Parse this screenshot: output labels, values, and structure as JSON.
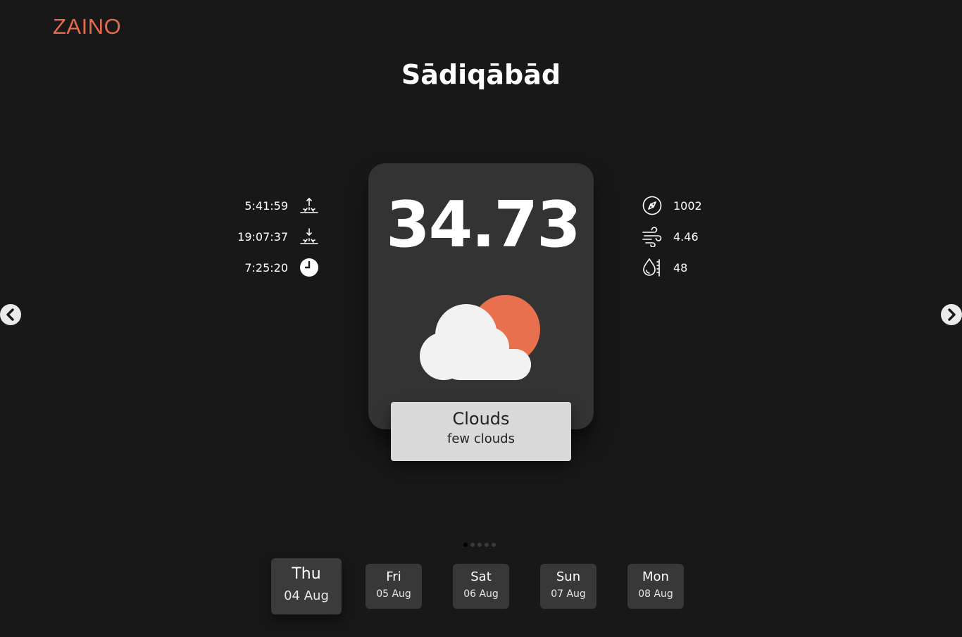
{
  "app": {
    "logo": "ZAINO"
  },
  "location": {
    "city": "Sādiqābād"
  },
  "sun": {
    "sunrise": "5:41:59",
    "sunset": "19:07:37",
    "daylight": "7:25:20"
  },
  "conditions": {
    "pressure": "1002",
    "wind": "4.46",
    "humidity": "48"
  },
  "current": {
    "temperature": "34.73",
    "main": "Clouds",
    "description": "few clouds",
    "icon": "cloud-sun-icon"
  },
  "colors": {
    "accent": "#e66a4c",
    "background": "#181818",
    "card": "#333333",
    "sun": "#e8704e",
    "cloud": "#f2f2f2"
  },
  "pager": {
    "total": 5,
    "active": 0
  },
  "forecast": [
    {
      "day": "Thu",
      "date": "04 Aug"
    },
    {
      "day": "Fri",
      "date": "05 Aug"
    },
    {
      "day": "Sat",
      "date": "06 Aug"
    },
    {
      "day": "Sun",
      "date": "07 Aug"
    },
    {
      "day": "Mon",
      "date": "08 Aug"
    }
  ]
}
